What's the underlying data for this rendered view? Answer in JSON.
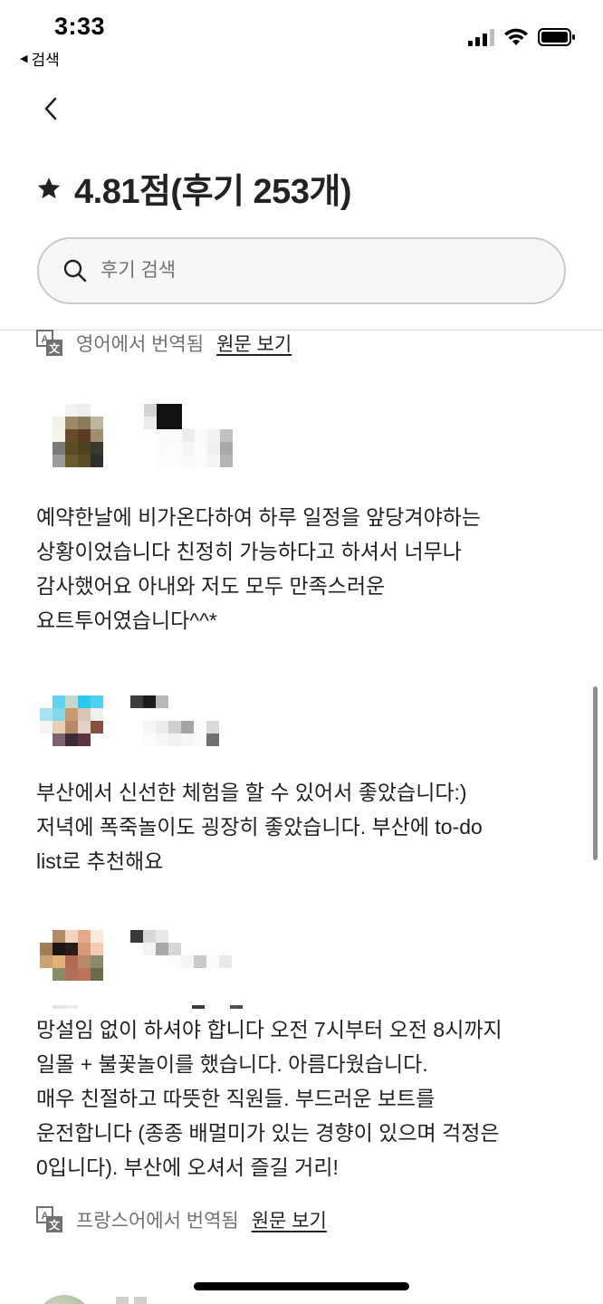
{
  "status_bar": {
    "time": "3:33",
    "back_label": "검색"
  },
  "header": {
    "rating_title": "4.81점(후기 253개)"
  },
  "search": {
    "placeholder": "후기 검색"
  },
  "reviews": [
    {
      "translation_note": "영어에서 번역됨",
      "original_link": "원문 보기"
    },
    {
      "text": "예약한날에 비가온다하여 하루 일정을 앞당겨야하는\n상황이었습니다 친정히 가능하다고 하셔서 너무나\n감사했어요 아내와 저도 모두 만족스러운\n요트투어였습니다^^*"
    },
    {
      "text": "부산에서 신선한 체험을 할 수 있어서 좋았습니다:)\n저녁에 폭죽놀이도 굉장히 좋았습니다. 부산에 to-do\nlist로 추천해요"
    },
    {
      "text": "망설임 없이 하셔야 합니다 오전 7시부터 오전 8시까지\n일몰 + 불꽃놀이를 했습니다. 아름다웠습니다.\n매우 친절하고 따뜻한 직원들. 부드러운 보트를\n운전합니다 (종종 배멀미가 있는 경향이 있으며 걱정은\n0입니다). 부산에 오셔서 즐길 거리!",
      "translation_note": "프랑스어에서 번역됨",
      "original_link": "원문 보기"
    }
  ],
  "icons": {
    "back": "chevron-left-icon",
    "star": "star-icon",
    "search": "search-icon",
    "translate": "translate-icon",
    "signal": "cellular-signal-icon",
    "wifi": "wifi-icon",
    "battery": "battery-icon"
  }
}
